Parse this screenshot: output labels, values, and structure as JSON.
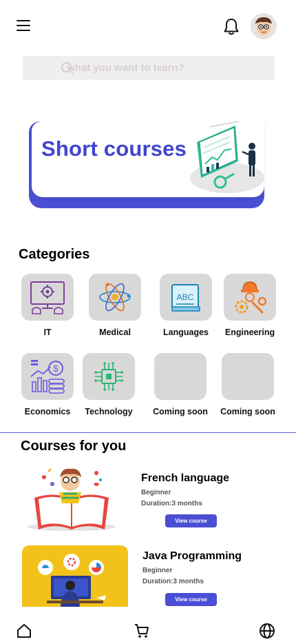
{
  "header": {
    "menu_icon": "hamburger-menu-icon",
    "bell_icon": "bell-icon",
    "avatar_icon": "user-avatar"
  },
  "search": {
    "placeholder": "what you want to learn?",
    "value": "",
    "icon": "search-icon"
  },
  "banner": {
    "title": "Short courses",
    "accent": "#4b4fd4",
    "title_color": "#4144cf"
  },
  "categories": {
    "title": "Categories",
    "items": [
      {
        "label": "IT",
        "icon": "computer-settings-icon"
      },
      {
        "label": "Medical",
        "icon": "atom-icon"
      },
      {
        "label": "Languages",
        "icon": "abc-book-icon"
      },
      {
        "label": "Engineering",
        "icon": "engineer-gears-icon"
      },
      {
        "label": "Economics",
        "icon": "finance-chart-icon"
      },
      {
        "label": "Technology",
        "icon": "chip-icon"
      },
      {
        "label": "Coming soon",
        "icon": ""
      },
      {
        "label": "Coming soon",
        "icon": ""
      }
    ]
  },
  "courses": {
    "title": "Courses for you",
    "items": [
      {
        "name": "French language",
        "level": "Beginner",
        "duration": "Duration:3 months",
        "button": "View course"
      },
      {
        "name": "Java Programming",
        "level": "Beginner",
        "duration": "Duration:3 months",
        "button": "View course"
      }
    ]
  },
  "bottom_nav": {
    "items": [
      {
        "icon": "home-icon"
      },
      {
        "icon": "cart-icon"
      },
      {
        "icon": "globe-icon"
      }
    ]
  },
  "colors": {
    "accent": "#4b4fd4",
    "tile_bg": "#d8d8d8",
    "search_bg": "#f1efee"
  }
}
